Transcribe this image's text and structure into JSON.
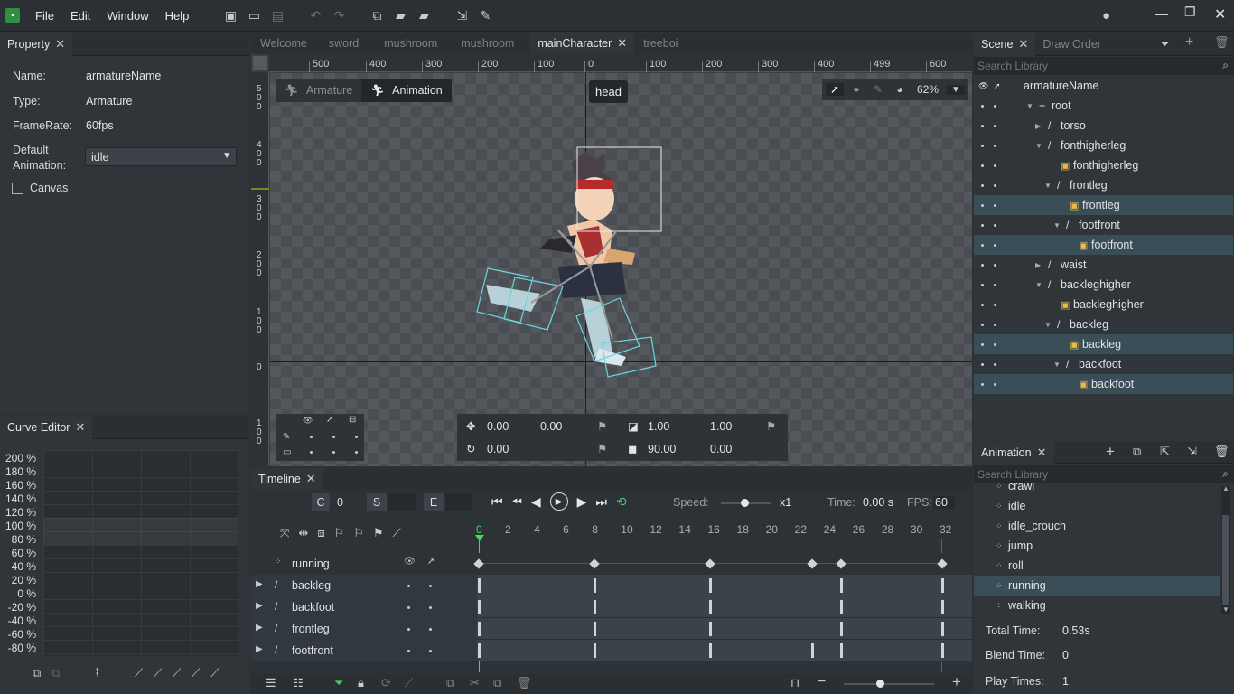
{
  "menu": {
    "items": [
      "File",
      "Edit",
      "Window",
      "Help"
    ]
  },
  "doc_tabs": [
    {
      "label": "Welcome"
    },
    {
      "label": "sword"
    },
    {
      "label": "mushroom"
    },
    {
      "label": "mushroom"
    },
    {
      "label": "mainCharacter",
      "active": true
    },
    {
      "label": "treeboi"
    }
  ],
  "property": {
    "title": "Property",
    "rows": [
      {
        "label": "Name:",
        "value": "armatureName"
      },
      {
        "label": "Type:",
        "value": "Armature"
      },
      {
        "label": "FrameRate:",
        "value": "60fps"
      }
    ],
    "default_anim_label_1": "Default",
    "default_anim_label_2": "Animation:",
    "default_anim_value": "idle",
    "canvas_label": "Canvas"
  },
  "curve_editor": {
    "title": "Curve Editor",
    "percent_labels": [
      "200 %",
      "180 %",
      "160 %",
      "140 %",
      "120 %",
      "100 %",
      "80 %",
      "60 %",
      "40 %",
      "20 %",
      "0 %",
      "-20 %",
      "-40 %",
      "-60 %",
      "-80 %"
    ]
  },
  "viewport": {
    "ruler_top": [
      "500",
      "400",
      "300",
      "200",
      "100",
      "0",
      "100",
      "200",
      "300",
      "400",
      "499",
      "600"
    ],
    "ruler_left": [
      [
        "5",
        "0",
        "0"
      ],
      [
        "4",
        "0",
        "0"
      ],
      [
        "3",
        "0",
        "0"
      ],
      [
        "2",
        "0",
        "0"
      ],
      [
        "1",
        "0",
        "0"
      ],
      [
        "0"
      ],
      [
        "1",
        "0",
        "0"
      ]
    ],
    "mode_armature": "Armature",
    "mode_animation": "Animation",
    "bone_tooltip": "head",
    "zoom": "62%",
    "transform": {
      "x": "0.00",
      "y": "0.00",
      "scale_x": "1.00",
      "scale_y": "1.00",
      "rotation": "0.00",
      "skew": "90.00",
      "skew2": "0.00"
    }
  },
  "scene": {
    "tab_scene": "Scene",
    "tab_draw_order": "Draw Order",
    "search_placeholder": "Search Library",
    "tree": [
      {
        "label": "armatureName",
        "indent": 0,
        "type": "armature"
      },
      {
        "label": "root",
        "indent": 1,
        "type": "bone",
        "arrow": "down"
      },
      {
        "label": "torso",
        "indent": 2,
        "type": "bone",
        "arrow": "right"
      },
      {
        "label": "fonthigherleg",
        "indent": 2,
        "type": "bone",
        "arrow": "down"
      },
      {
        "label": "fonthigherleg",
        "indent": 3,
        "type": "image"
      },
      {
        "label": "frontleg",
        "indent": 3,
        "type": "bone",
        "arrow": "down"
      },
      {
        "label": "frontleg",
        "indent": 4,
        "type": "image",
        "selected": true
      },
      {
        "label": "footfront",
        "indent": 4,
        "type": "bone",
        "arrow": "down"
      },
      {
        "label": "footfront",
        "indent": 5,
        "type": "image",
        "selected": true
      },
      {
        "label": "waist",
        "indent": 2,
        "type": "bone",
        "arrow": "right"
      },
      {
        "label": "backleghigher",
        "indent": 2,
        "type": "bone",
        "arrow": "down"
      },
      {
        "label": "backleghigher",
        "indent": 3,
        "type": "image"
      },
      {
        "label": "backleg",
        "indent": 3,
        "type": "bone",
        "arrow": "down"
      },
      {
        "label": "backleg",
        "indent": 4,
        "type": "image",
        "selected": true
      },
      {
        "label": "backfoot",
        "indent": 4,
        "type": "bone",
        "arrow": "down"
      },
      {
        "label": "backfoot",
        "indent": 5,
        "type": "image",
        "selected": true
      }
    ]
  },
  "animation": {
    "title": "Animation",
    "search_placeholder": "Search Library",
    "items": [
      "crawl",
      "idle",
      "idle_crouch",
      "jump",
      "roll",
      "running",
      "walking"
    ],
    "selected": "running",
    "total_time_label": "Total Time:",
    "total_time": "0.53s",
    "blend_time_label": "Blend Time:",
    "blend_time": "0",
    "play_times_label": "Play Times:",
    "play_times": "1"
  },
  "timeline": {
    "title": "Timeline",
    "c_label": "C",
    "c_value": "0",
    "s_label": "S",
    "e_label": "E",
    "speed_label": "Speed:",
    "speed_value": "x1",
    "time_label": "Time:",
    "time_value": "0.00 s",
    "fps_label": "FPS:",
    "fps_value": "60",
    "frame_numbers": [
      "0",
      "2",
      "4",
      "6",
      "8",
      "10",
      "12",
      "14",
      "16",
      "18",
      "20",
      "22",
      "24",
      "26",
      "28",
      "30",
      "32"
    ],
    "tracks": [
      {
        "label": "running",
        "keys": [
          0,
          8,
          16,
          23,
          25,
          32
        ]
      },
      {
        "label": "backleg",
        "keys": [
          0,
          8,
          16,
          25,
          32
        ]
      },
      {
        "label": "backfoot",
        "keys": [
          0,
          8,
          16,
          25,
          32
        ]
      },
      {
        "label": "frontleg",
        "keys": [
          0,
          8,
          16,
          25,
          32
        ]
      },
      {
        "label": "footfront",
        "keys": [
          0,
          8,
          16,
          23,
          25,
          32
        ]
      }
    ]
  }
}
